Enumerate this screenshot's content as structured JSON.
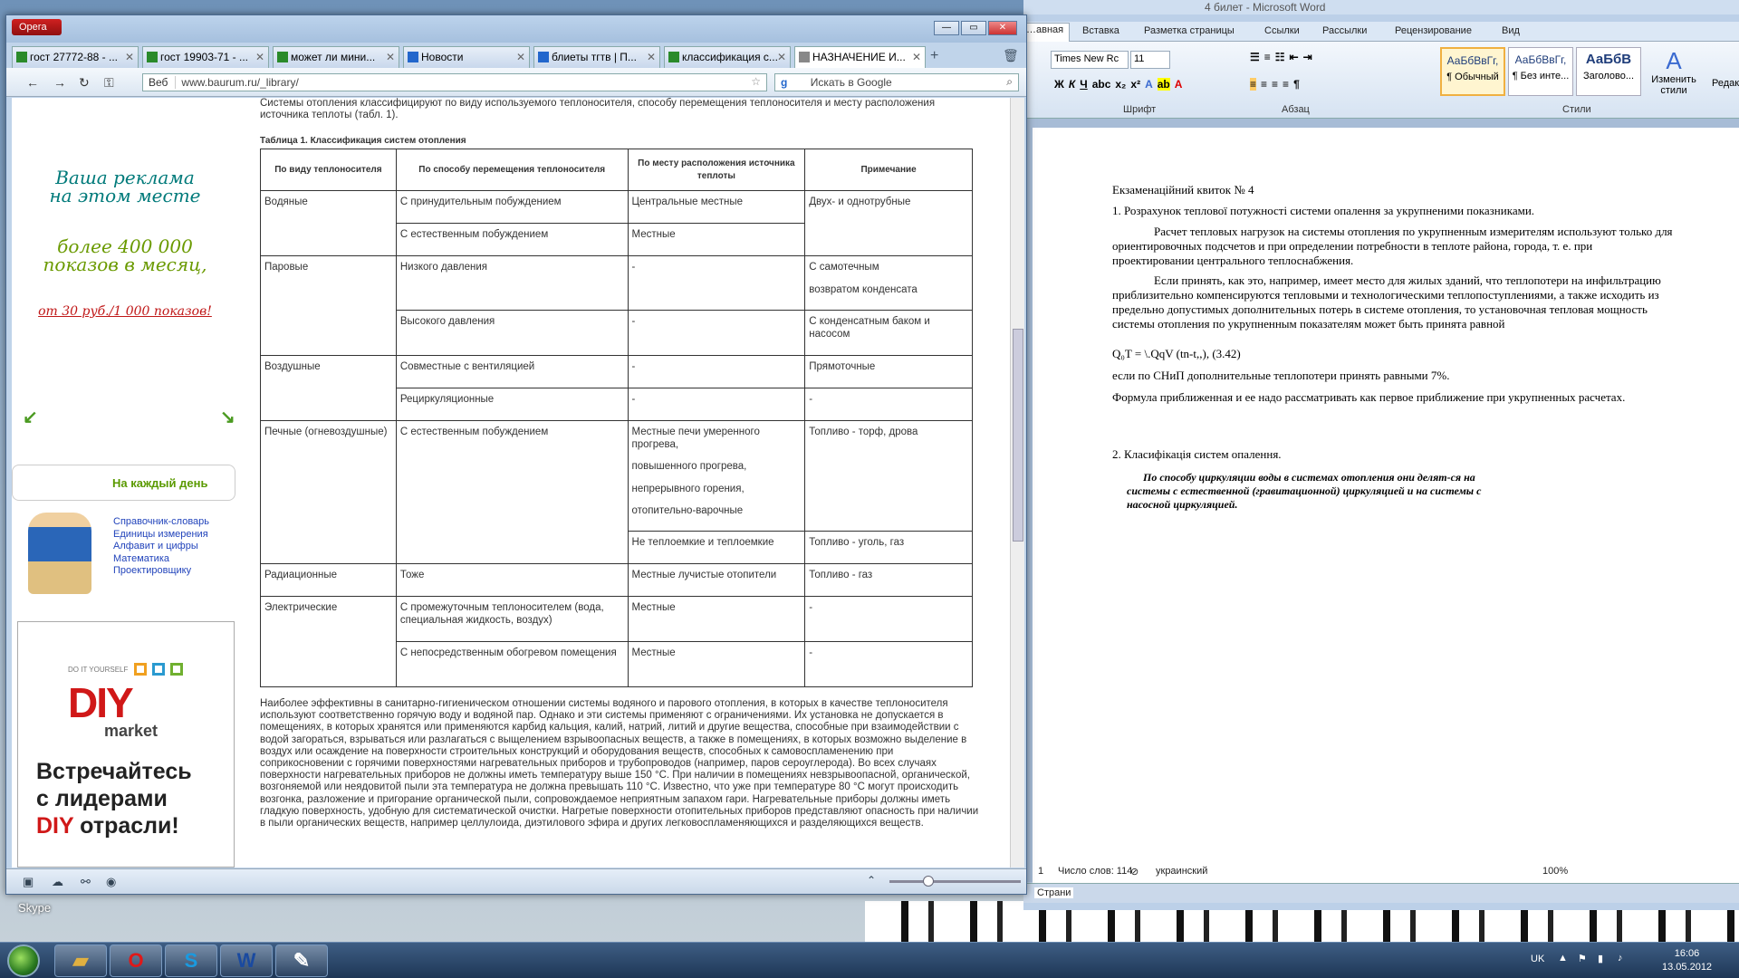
{
  "desktop": {
    "skype_label": "Skype"
  },
  "word": {
    "title": "4 билет - Microsoft Word",
    "tabs": [
      "…авная",
      "Вставка",
      "Разметка страницы",
      "Ссылки",
      "Рассылки",
      "Рецензирование",
      "Вид"
    ],
    "font_name": "Times New Rc",
    "font_size": "11",
    "group_font": "Шрифт",
    "group_paragraph": "Абзац",
    "group_styles": "Стили",
    "styles": [
      {
        "sample": "АаБбВвГг,",
        "name": "¶ Обычный"
      },
      {
        "sample": "АаБбВвГг,",
        "name": "¶ Без инте..."
      },
      {
        "sample": "АаБбВ",
        "name": "Заголово..."
      }
    ],
    "change_styles": "Изменить стили",
    "edit_label": "Редак",
    "doc": {
      "heading": "Екзаменаційний квиток № 4",
      "q1": "1. Розрахунок теплової потужності системи опалення за укрупненими показниками.",
      "p1": "Расчет тепловых нагрузок на системы отопления по укрупненным измерителям используют только для ориентировочных подсчетов и при определении потребности в теплоте района, города, т. е. при проектировании центрального теплоснабжения.",
      "p2": "Если принять, как это, например, имеет место для жилых зданий, что теплопотери на инфильтрацию приблизительно компенсируются тепловыми и технологическими теплопоступлениями, а также исходить из предельно допустимых дополнительных потерь в системе отопления, то установочная тепловая мощность системы отопления по укрупненным показателям может быть принята равной",
      "formula": "Q₀T = \\.QqV (tn-t,,), (3.42)",
      "p3": "если по СНиП дополнительные теплопотери принять равными 7%.",
      "p4": "Формула приближенная и ее надо рассматривать как первое приближение при укрупненных расчетах.",
      "q2": "2. Класифікація систем опалення.",
      "p5": "По способу циркуляции воды в системах отопления они делят-ся на системы с естественной (гравитационной) циркуляцией и на системы с насосной циркуляцией."
    },
    "status": {
      "page_num": "1",
      "word_count": "Число слов: 114",
      "language": "украинский",
      "zoom": "100%",
      "strip_label": "Страни"
    }
  },
  "opera": {
    "menu_label": "Opera",
    "tabs": [
      "гост 27772-88 - ...",
      "гост 19903-71 - ...",
      "может ли мини...",
      "Новости",
      "блиеты тгтв | П...",
      "классификация с...",
      "НАЗНАЧЕНИЕ И..."
    ],
    "web_label": "Веб",
    "url": "www.baurum.ru/_library/",
    "search_placeholder": "Искать в Google",
    "page": {
      "ad1_line1": "Ваша реклама",
      "ad1_line2": "на этом месте",
      "ad1_line3": "более 400 000",
      "ad1_line4": "показов в месяц,",
      "ad1_line5": "от 30 руб./1 000 показов!",
      "every_day": "На каждый день",
      "links": [
        "Справочник-словарь",
        "Единицы измерения",
        "Алфавит и цифры",
        "Математика",
        "Проектировщику"
      ],
      "diy_small": "DO IT YOURSELF",
      "diy_logo": "DIY",
      "diy_market": "market",
      "diy_slogan_1": "Встречайтесь",
      "diy_slogan_2": "с лидерами",
      "diy_slogan_3a": "DIY",
      "diy_slogan_3b": " отрасли!",
      "intro": "Системы отопления классифицируют по виду используемого теплоносителя, способу перемещения теплоносителя и месту расположения источника теплоты (табл. 1).",
      "table_caption": "Таблица 1. Классификация систем отопления",
      "table_headers": [
        "По виду теплоносителя",
        "По способу перемещения теплоносителя",
        "По месту расположения источника теплоты",
        "Примечание"
      ],
      "rows": {
        "r1": [
          "Водяные",
          "С принудительным побуждением",
          "Центральные местные",
          "Двух- и однотрубные"
        ],
        "r2": [
          "С естественным побуждением",
          "Местные"
        ],
        "r3": [
          "Паровые",
          "Низкого давления",
          "-",
          "С самотечным",
          "возвратом конденсата"
        ],
        "r4": [
          "Высокого давления",
          "-",
          "С конденсатным баком и насосом"
        ],
        "r5": [
          "Воздушные",
          "Совместные с вентиляцией",
          "-",
          "Прямоточные"
        ],
        "r6": [
          "Рециркуляционные",
          "-",
          "-"
        ],
        "r7": [
          "Печные (огневоздушные)",
          "С естественным побуждением",
          "Местные печи умеренного прогрева,",
          "повышенного прогрева,",
          "непрерывного горения,",
          "отопительно-варочные",
          "Топливо - торф, дрова"
        ],
        "r8": [
          "Не теплоемкие и теплоемкие",
          "Топливо - уголь, газ"
        ],
        "r9": [
          "Радиационные",
          "Тоже",
          "Местные лучистые отопители",
          "Топливо - газ"
        ],
        "r10": [
          "Электрические",
          "С промежуточным теплоносителем (вода, специальная жидкость, воздух)",
          "Местные",
          "-"
        ],
        "r11": [
          "С непосредственным обогревом помещения",
          "Местные",
          "-"
        ]
      },
      "body": "Наиболее эффективны в санитарно-гигиеническом отношении системы водяного и парового отопления, в которых в качестве теплоносителя используют соответственно горячую воду и водяной пар. Однако и эти системы применяют с ограничениями. Их установка не допускается в помещениях, в которых хранятся или применяются карбид кальция, калий, натрий, литий и другие вещества, способные при взаимодействии с водой загораться, взрываться или разлагаться с выщелением взрывоопасных веществ, а также в помещениях, в которых возможно выделение в воздух или осаждение на поверхности строительных конструкций и оборудования веществ, способных к самовоспламенению при соприкосновении с горячими поверхностями нагревательных приборов и трубопроводов (например, паров сероуглерода). Во всех случаях поверхности нагревательных приборов не должны иметь температуру выше 150 °С. При наличии в помещениях невзрывоопасной, органической, возгоняемой или неядовитой пыли эта температура не должна превышать 110 °С. Известно, что уже при температуре 80 °С могут происходить возгонка, разложение и пригорание органической пыли, сопровождаемое неприятным запахом гари. Нагревательные приборы должны иметь гладкую поверхность, удобную для систематической очистки. Нагретые поверхности отопительных приборов представляют опасность при наличии в пыли органических веществ, например целлулоида, диэтилового эфира и других легковоспламеняющихся и разделяющихся веществ."
    }
  },
  "taskbar": {
    "lang": "UK",
    "time": "16:06",
    "date": "13.05.2012"
  }
}
